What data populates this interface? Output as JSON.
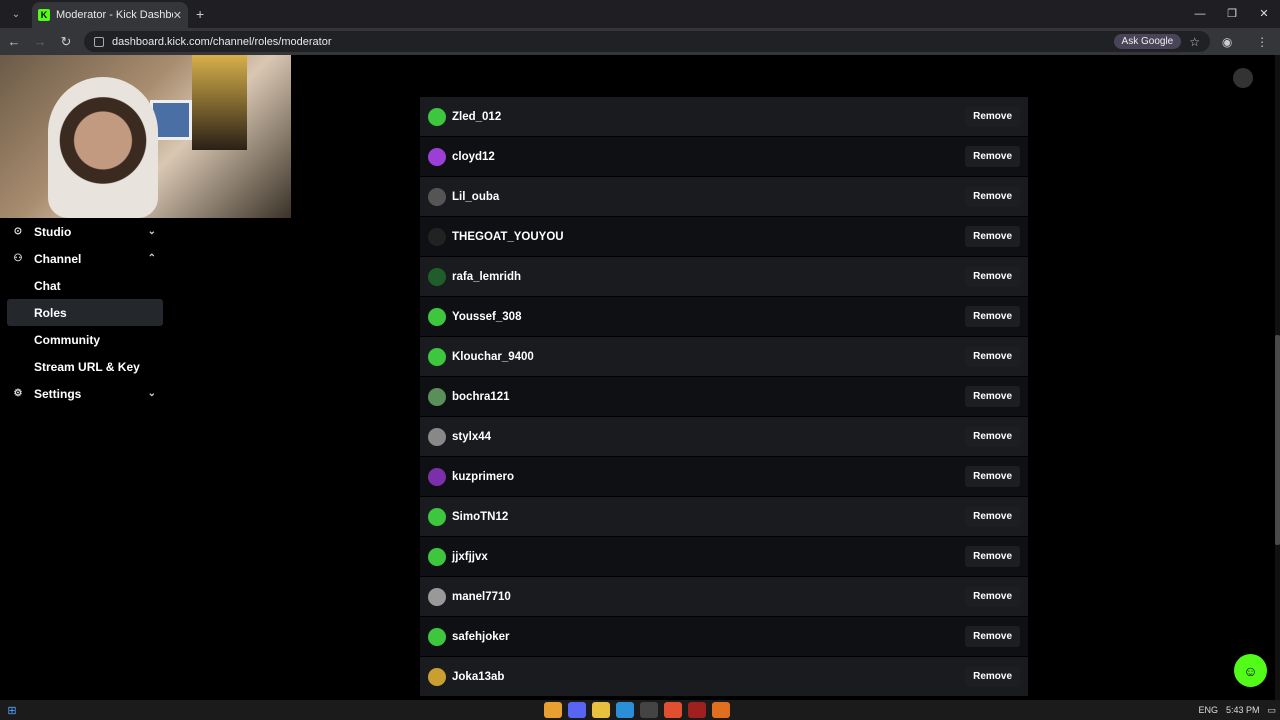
{
  "browser": {
    "tab_title": "Moderator - Kick Dashboard",
    "tab_favicon": "K",
    "url": "dashboard.kick.com/channel/roles/moderator",
    "ask_google": "Ask Google",
    "close_glyph": "✕",
    "new_tab_glyph": "+"
  },
  "sidebar": {
    "studio": "Studio",
    "channel": "Channel",
    "chat": "Chat",
    "roles": "Roles",
    "community": "Community",
    "stream_url": "Stream URL & Key",
    "settings": "Settings"
  },
  "moderators": [
    {
      "name": "Zled_012",
      "avatar_color": "#3ec63e"
    },
    {
      "name": "cloyd12",
      "avatar_color": "#9b3fd6"
    },
    {
      "name": "Lil_ouba",
      "avatar_color": "#555555"
    },
    {
      "name": "THEGOAT_YOUYOU",
      "avatar_color": "#222222"
    },
    {
      "name": "rafa_lemridh",
      "avatar_color": "#1f5e2a"
    },
    {
      "name": "Youssef_308",
      "avatar_color": "#3ec63e"
    },
    {
      "name": "Klouchar_9400",
      "avatar_color": "#3ec63e"
    },
    {
      "name": "bochra121",
      "avatar_color": "#5a8f5a"
    },
    {
      "name": "stylx44",
      "avatar_color": "#888888"
    },
    {
      "name": "kuzprimero",
      "avatar_color": "#7b2fa8"
    },
    {
      "name": "SimoTN12",
      "avatar_color": "#3ec63e"
    },
    {
      "name": "jjxfjjvx",
      "avatar_color": "#3ec63e"
    },
    {
      "name": "manel7710",
      "avatar_color": "#999999"
    },
    {
      "name": "safehjoker",
      "avatar_color": "#3ec63e"
    },
    {
      "name": "Joka13ab",
      "avatar_color": "#c9a030"
    }
  ],
  "remove_label": "Remove",
  "taskbar": {
    "lang": "ENG",
    "time": "5:43 PM"
  },
  "colors": {
    "brand": "#53fc18",
    "background": "#000000"
  }
}
